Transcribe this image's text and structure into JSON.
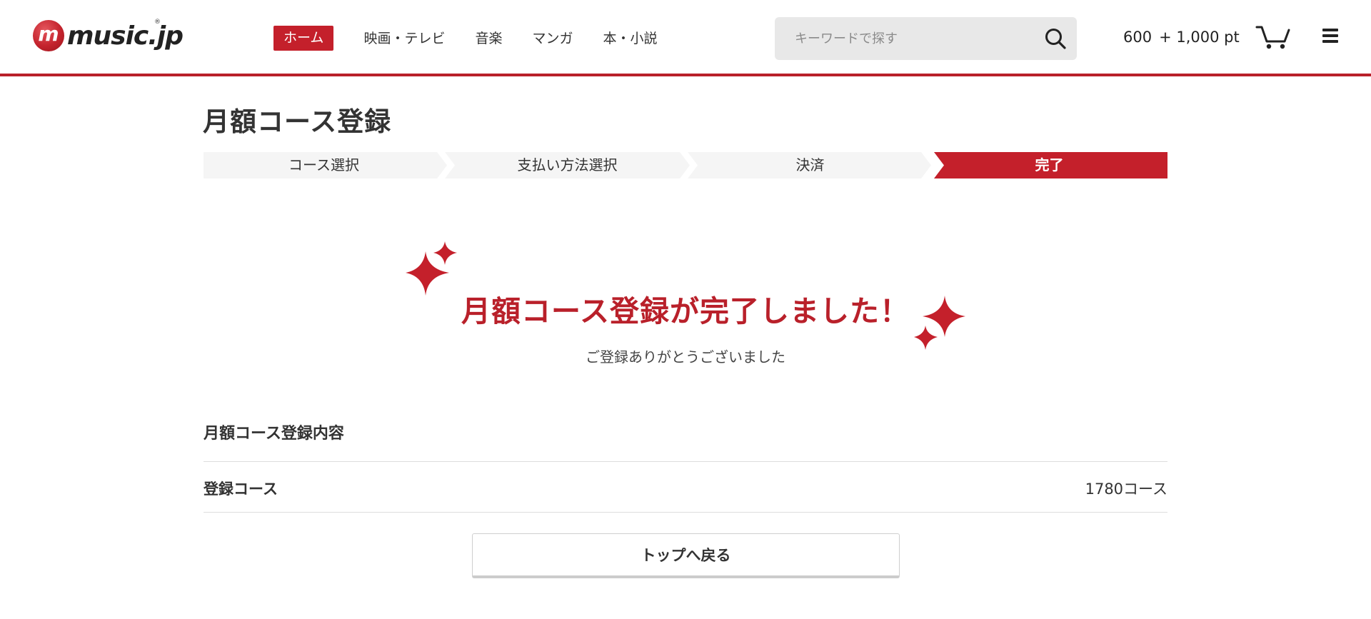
{
  "header": {
    "logo": {
      "mark": "m",
      "text": "music.jp",
      "reg": "®",
      "icon": "music-jp-logo"
    },
    "nav": [
      {
        "label": "ホーム",
        "active": true
      },
      {
        "label": "映画・テレビ",
        "active": false
      },
      {
        "label": "音楽",
        "active": false
      },
      {
        "label": "マンガ",
        "active": false
      },
      {
        "label": "本・小説",
        "active": false
      }
    ],
    "search": {
      "placeholder": "キーワードで探す",
      "value": "",
      "icon": "search-icon"
    },
    "points": {
      "base": "600",
      "bonus": "+ 1,000 pt"
    },
    "cart_icon": "cart-icon",
    "menu_icon": "hamburger-menu-icon"
  },
  "page": {
    "title": "月額コース登録",
    "steps": [
      {
        "label": "コース選択",
        "current": false
      },
      {
        "label": "支払い方法選択",
        "current": false
      },
      {
        "label": "決済",
        "current": false
      },
      {
        "label": "完了",
        "current": true
      }
    ],
    "complete": {
      "title": "月額コース登録が完了しました！",
      "subtitle": "ご登録ありがとうございました"
    },
    "details": {
      "section_title": "月額コース登録内容",
      "rows": [
        {
          "label": "登録コース",
          "value": "1780コース"
        }
      ]
    },
    "back_button": "トップへ戻る"
  },
  "colors": {
    "accent": "#b9202a",
    "step_bg": "#f5f5f5",
    "search_bg": "#e8e8e8"
  }
}
